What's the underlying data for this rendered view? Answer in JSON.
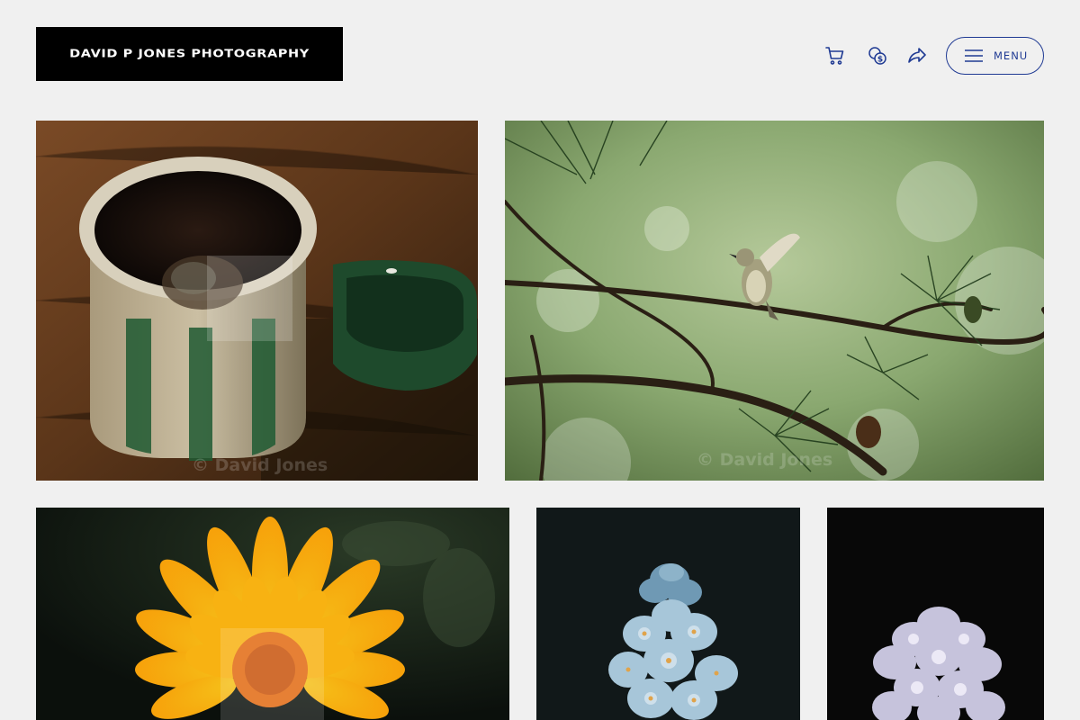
{
  "site": {
    "brand": "DAVID P JONES PHOTOGRAPHY"
  },
  "header": {
    "icons": [
      {
        "name": "cart-icon",
        "label": "Cart"
      },
      {
        "name": "currency-icon",
        "label": "Currency"
      },
      {
        "name": "share-icon",
        "label": "Share"
      }
    ],
    "menu_label": "MENU"
  },
  "colors": {
    "background": "#f0f0f0",
    "accent": "#1f3a93",
    "logo_bg": "#000000"
  },
  "gallery": {
    "watermark": "© David Jones",
    "photos": [
      {
        "subject": "coffee mug on wooden table"
      },
      {
        "subject": "bird on pine branch"
      },
      {
        "subject": "yellow flower"
      },
      {
        "subject": "blue flower"
      },
      {
        "subject": "white-lilac flower"
      }
    ]
  }
}
